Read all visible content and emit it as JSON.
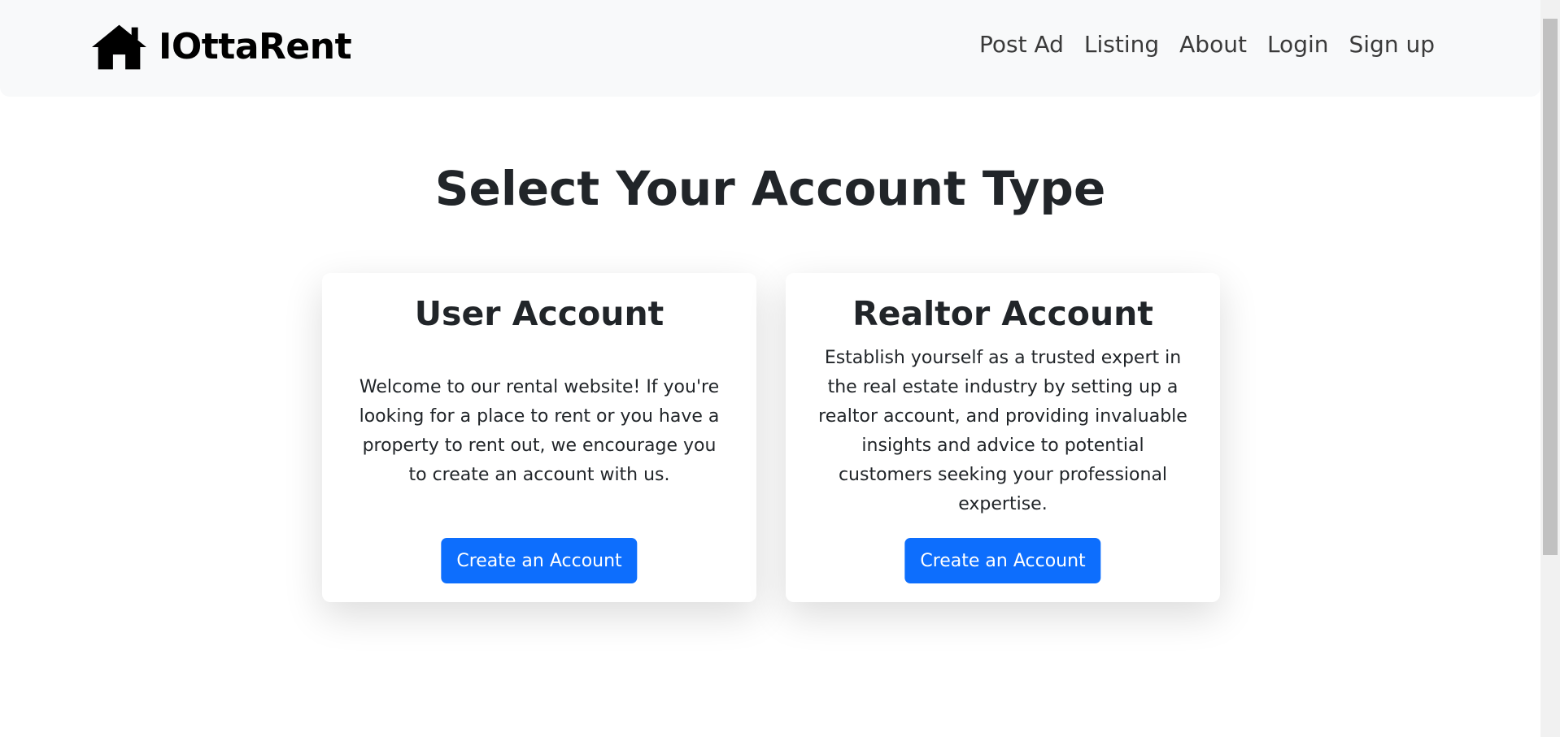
{
  "navbar": {
    "brand": "IOttaRent",
    "brand_icon": "house-icon",
    "links": [
      {
        "label": "Post Ad"
      },
      {
        "label": "Listing"
      },
      {
        "label": "About"
      },
      {
        "label": "Login"
      },
      {
        "label": "Sign up"
      }
    ]
  },
  "main": {
    "title": "Select Your Account Type",
    "cards": [
      {
        "title": "User Account",
        "text": "Welcome to our rental website! If you're looking for a place to rent or you have a property to rent out, we encourage you to create an account with us.",
        "button": "Create an Account"
      },
      {
        "title": "Realtor Account",
        "text": "Establish yourself as a trusted expert in the real estate industry by setting up a realtor account, and providing invaluable insights and advice to potential customers seeking your professional expertise.",
        "button": "Create an Account"
      }
    ]
  },
  "colors": {
    "primary": "#0d6efd",
    "navbar_bg": "#f8f9fa",
    "text": "#212529"
  }
}
